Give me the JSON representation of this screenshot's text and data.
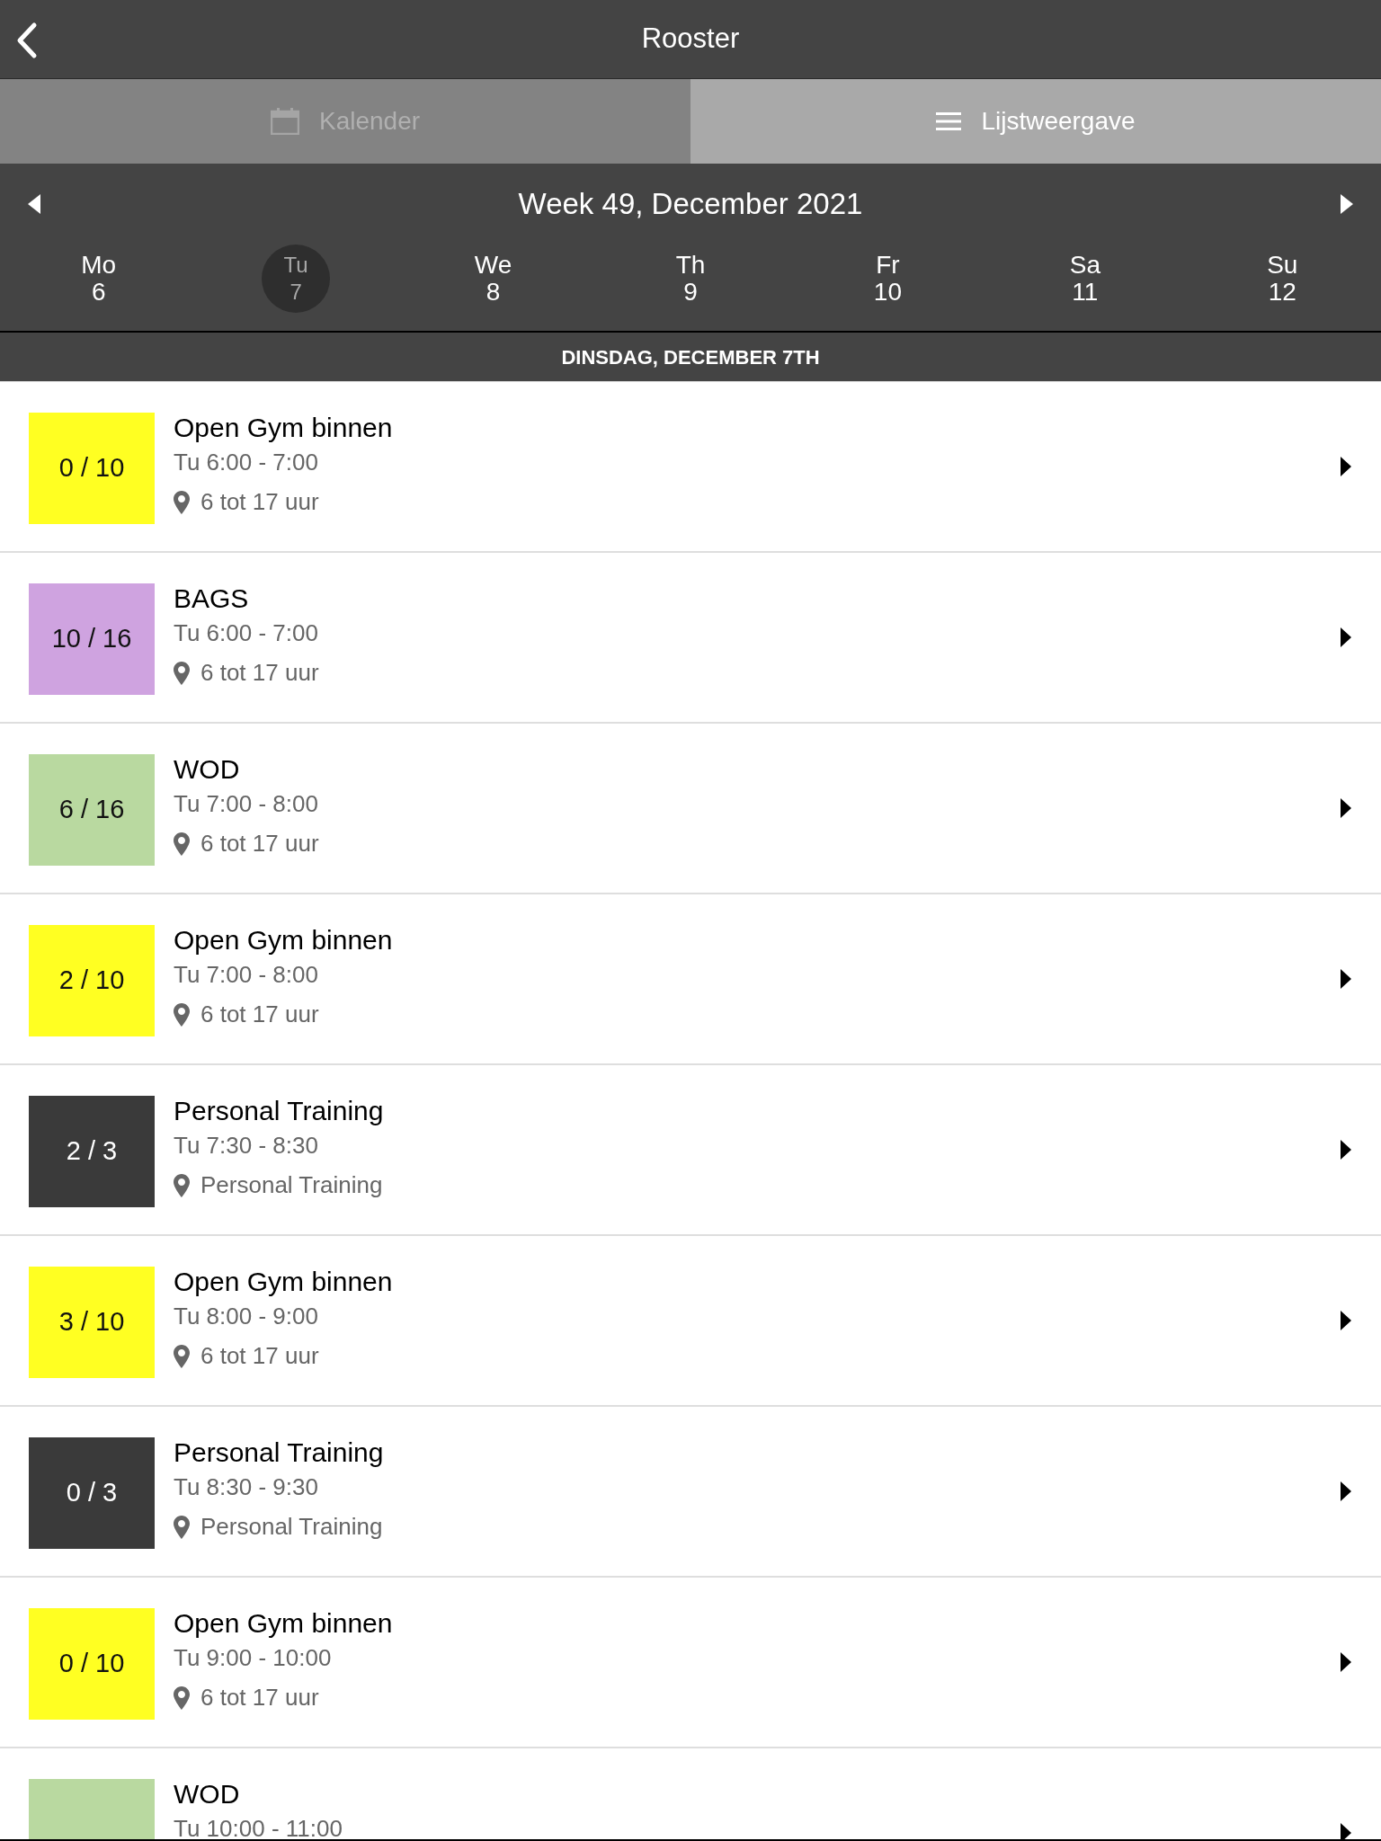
{
  "header": {
    "title": "Rooster"
  },
  "tabs": [
    {
      "label": "Kalender",
      "kind": "calendar",
      "selected": false
    },
    {
      "label": "Lijstweergave",
      "kind": "list",
      "selected": true
    }
  ],
  "week": {
    "title": "Week 49, December 2021"
  },
  "days": [
    {
      "name": "Mo",
      "date": "6",
      "selected": false
    },
    {
      "name": "Tu",
      "date": "7",
      "selected": true
    },
    {
      "name": "We",
      "date": "8",
      "selected": false
    },
    {
      "name": "Th",
      "date": "9",
      "selected": false
    },
    {
      "name": "Fr",
      "date": "10",
      "selected": false
    },
    {
      "name": "Sa",
      "date": "11",
      "selected": false
    },
    {
      "name": "Su",
      "date": "12",
      "selected": false
    }
  ],
  "section": "DINSDAG, DECEMBER 7TH",
  "classes": [
    {
      "count": "0 / 10",
      "color": "#ffff22",
      "title": "Open Gym binnen",
      "time": "Tu 6:00 - 7:00",
      "location": "6 tot 17 uur"
    },
    {
      "count": "10 / 16",
      "color": "#cfa3e0",
      "title": "BAGS",
      "time": "Tu 6:00 - 7:00",
      "location": "6 tot 17 uur"
    },
    {
      "count": "6 / 16",
      "color": "#b9d9a0",
      "title": "WOD",
      "time": "Tu 7:00 - 8:00",
      "location": "6 tot 17 uur"
    },
    {
      "count": "2 / 10",
      "color": "#ffff22",
      "title": "Open Gym binnen",
      "time": "Tu 7:00 - 8:00",
      "location": "6 tot 17 uur"
    },
    {
      "count": "2 / 3",
      "color": "#3a3a3a",
      "title": "Personal Training",
      "time": "Tu 7:30 - 8:30",
      "location": "Personal Training"
    },
    {
      "count": "3 / 10",
      "color": "#ffff22",
      "title": "Open Gym binnen",
      "time": "Tu 8:00 - 9:00",
      "location": "6 tot 17 uur"
    },
    {
      "count": "0 / 3",
      "color": "#3a3a3a",
      "title": "Personal Training",
      "time": "Tu 8:30 - 9:30",
      "location": "Personal Training"
    },
    {
      "count": "0 / 10",
      "color": "#ffff22",
      "title": "Open Gym binnen",
      "time": "Tu 9:00 - 10:00",
      "location": "6 tot 17 uur"
    },
    {
      "color": "#b9d9a0",
      "title": "WOD",
      "time": "Tu 10:00 - 11:00"
    }
  ]
}
